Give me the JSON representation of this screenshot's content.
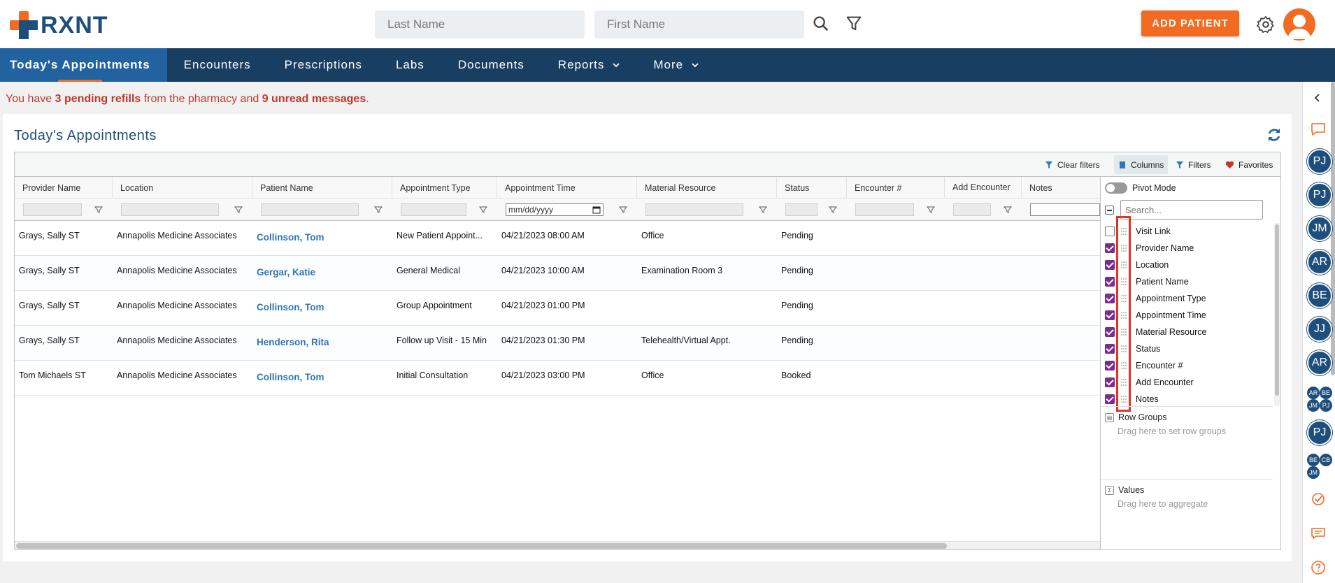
{
  "header": {
    "logo_text": "RXNT",
    "last_name_placeholder": "Last Name",
    "first_name_placeholder": "First Name",
    "add_patient_label": "ADD PATIENT",
    "brand_color": "#f26b21",
    "nav_color": "#183e62"
  },
  "nav": {
    "items": [
      {
        "label": "Today's Appointments"
      },
      {
        "label": "Encounters"
      },
      {
        "label": "Prescriptions"
      },
      {
        "label": "Labs"
      },
      {
        "label": "Documents"
      },
      {
        "label": "Reports"
      },
      {
        "label": "More"
      }
    ]
  },
  "alert": {
    "prefix": "You have ",
    "refills": "3 pending refills",
    "middle": " from the pharmacy and ",
    "messages": "9 unread messages",
    "suffix": "."
  },
  "panel": {
    "title": "Today's Appointments"
  },
  "toolbar": {
    "clear_filters": "Clear filters",
    "columns": "Columns",
    "filters": "Filters",
    "favorites": "Favorites"
  },
  "columns": [
    {
      "label": "Provider Name"
    },
    {
      "label": "Location"
    },
    {
      "label": "Patient Name"
    },
    {
      "label": "Appointment Type"
    },
    {
      "label": "Appointment Time"
    },
    {
      "label": "Material Resource"
    },
    {
      "label": "Status"
    },
    {
      "label": "Encounter #"
    },
    {
      "label": "Add Encounter"
    },
    {
      "label": "Notes"
    }
  ],
  "date_placeholder": "mm/dd/yyyy",
  "rows": [
    {
      "provider": "Grays, Sally ST",
      "location": "Annapolis Medicine Associates",
      "patient": "Collinson, Tom",
      "type": "New Patient Appoint...",
      "time": "04/21/2023 08:00 AM",
      "resource": "Office",
      "status": "Pending"
    },
    {
      "provider": "Grays, Sally ST",
      "location": "Annapolis Medicine Associates",
      "patient": "Gergar, Katie",
      "type": "General Medical",
      "time": "04/21/2023 10:00 AM",
      "resource": "Examination Room 3",
      "status": "Pending"
    },
    {
      "provider": "Grays, Sally ST",
      "location": "Annapolis Medicine Associates",
      "patient": "Collinson, Tom",
      "type": "Group Appointment",
      "time": "04/21/2023 01:00 PM",
      "resource": "",
      "status": "Pending"
    },
    {
      "provider": "Grays, Sally ST",
      "location": "Annapolis Medicine Associates",
      "patient": "Henderson, Rita",
      "type": "Follow up Visit - 15 Min",
      "time": "04/21/2023 01:30 PM",
      "resource": "Telehealth/Virtual Appt.",
      "status": "Pending"
    },
    {
      "provider": "Tom Michaels ST",
      "location": "Annapolis Medicine Associates",
      "patient": "Collinson, Tom",
      "type": "Initial Consultation",
      "time": "04/21/2023 03:00 PM",
      "resource": "Office",
      "status": "Booked"
    }
  ],
  "side_panel": {
    "pivot_mode": "Pivot Mode",
    "search_placeholder": "Search...",
    "column_list": [
      {
        "label": "Visit Link",
        "checked": false
      },
      {
        "label": "Provider Name",
        "checked": true
      },
      {
        "label": "Location",
        "checked": true
      },
      {
        "label": "Patient Name",
        "checked": true
      },
      {
        "label": "Appointment Type",
        "checked": true
      },
      {
        "label": "Appointment Time",
        "checked": true
      },
      {
        "label": "Material Resource",
        "checked": true
      },
      {
        "label": "Status",
        "checked": true
      },
      {
        "label": "Encounter #",
        "checked": true
      },
      {
        "label": "Add Encounter",
        "checked": true
      },
      {
        "label": "Notes",
        "checked": true
      }
    ],
    "row_groups_title": "Row Groups",
    "row_groups_hint": "Drag here to set row groups",
    "values_title": "Values",
    "values_hint": "Drag here to aggregate"
  },
  "rail": {
    "avatars": [
      "PJ",
      "PJ",
      "JM",
      "AR",
      "BE",
      "JJ",
      "AR",
      "PJ"
    ],
    "mini_group_1": [
      "AR",
      "BE",
      "JM",
      "PJ"
    ],
    "mini_group_2": [
      "BE",
      "CB",
      "JM"
    ]
  }
}
